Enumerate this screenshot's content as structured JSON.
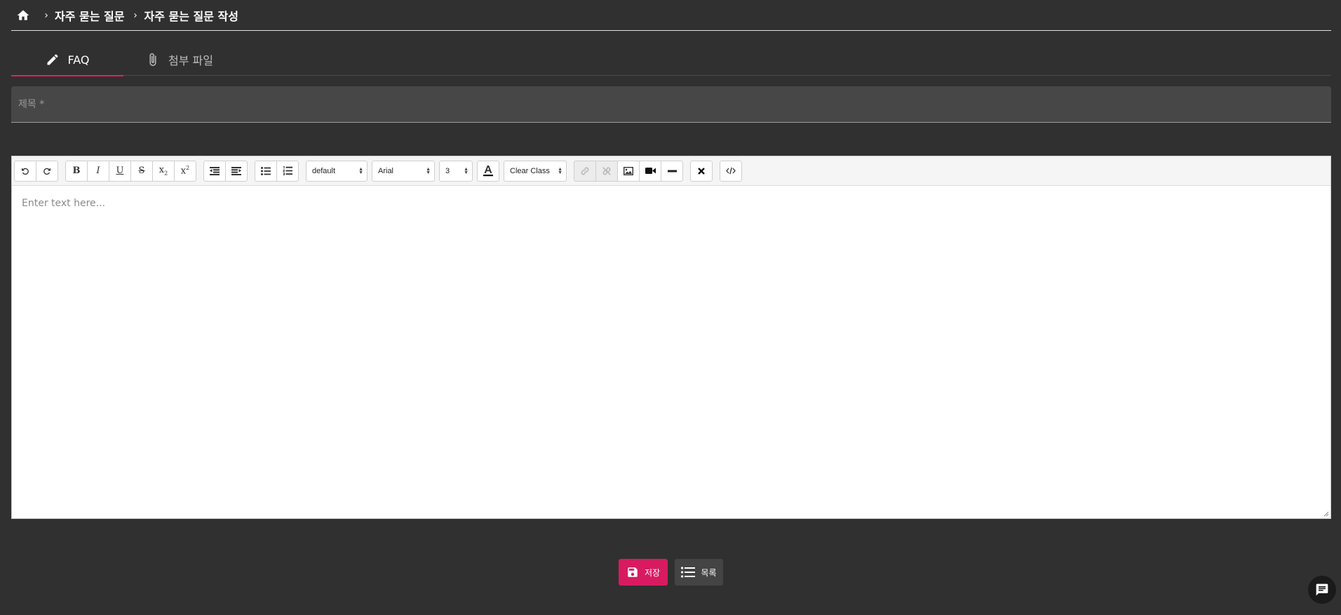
{
  "breadcrumb": {
    "items": [
      "자주 묻는 질문",
      "자주 묻는 질문 작성"
    ]
  },
  "tabs": [
    {
      "label": "FAQ",
      "icon": "pencil-icon",
      "active": true
    },
    {
      "label": "첨부 파일",
      "icon": "paperclip-icon",
      "active": false
    }
  ],
  "form": {
    "title_placeholder": "제목 *",
    "editor_placeholder": "Enter text here..."
  },
  "toolbar": {
    "style_select": "default",
    "font_select": "Arial",
    "size_select": "3",
    "class_select": "Clear Class"
  },
  "actions": {
    "save_label": "저장",
    "list_label": "목록"
  },
  "colors": {
    "background": "#303030",
    "accent": "#e91e63",
    "save_button": "#d81b60"
  }
}
